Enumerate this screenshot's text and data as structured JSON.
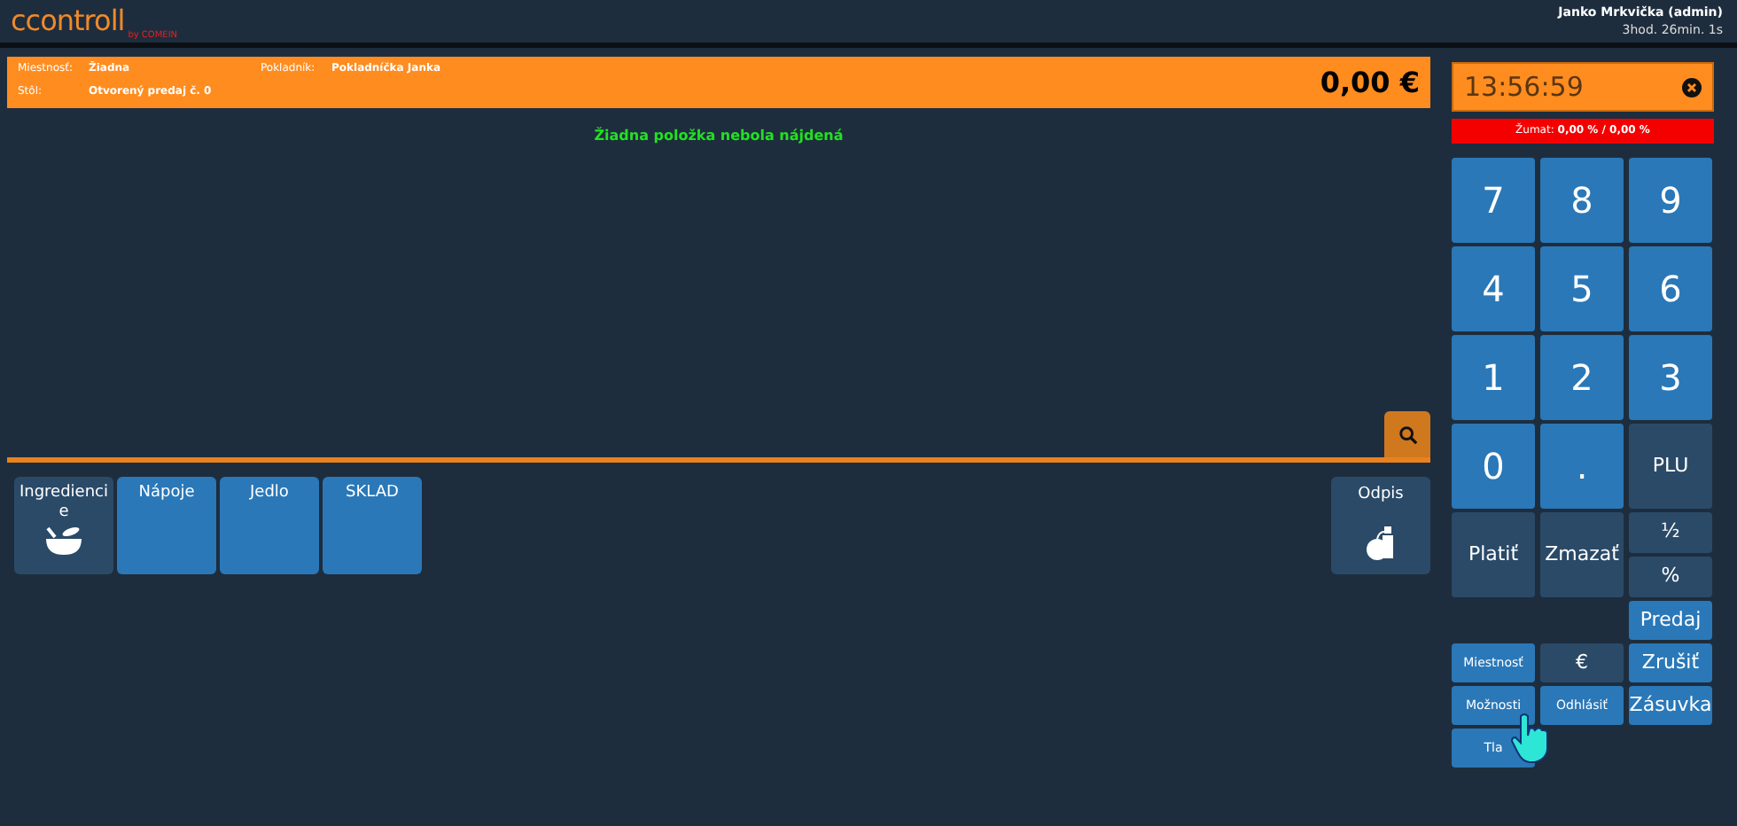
{
  "header": {
    "logo": "ccontroll",
    "logo_suffix": "by COMEIN",
    "user": "Janko Mrkvička (admin)",
    "session": "3hod. 26min. 1s"
  },
  "info_bar": {
    "fields": [
      {
        "label": "Miestnosť:",
        "value": "Žiadna"
      },
      {
        "label": "Pokladník:",
        "value": "Pokladníčka Janka"
      },
      {
        "label": "Stôl:",
        "value": "Otvorený predaj č. **0**"
      }
    ],
    "total": "0,00 €"
  },
  "message": "Žiadna položka nebola nájdená",
  "categories": [
    {
      "label": "Ingrediencie",
      "kind": "folder"
    },
    {
      "label": "Nápoje",
      "kind": "category"
    },
    {
      "label": "Jedlo",
      "kind": "category"
    },
    {
      "label": "SKLAD",
      "kind": "category"
    }
  ],
  "write_off": {
    "label": "Odpis"
  },
  "clock": "13:56:59",
  "discount": {
    "label": "Žumat:",
    "value": "0,00 % / 0,00 %"
  },
  "keys": [
    {
      "label": "7",
      "kind": "digit"
    },
    {
      "label": "8",
      "kind": "digit"
    },
    {
      "label": "9",
      "kind": "digit"
    },
    {
      "label": "4",
      "kind": "digit"
    },
    {
      "label": "5",
      "kind": "digit"
    },
    {
      "label": "6",
      "kind": "digit"
    },
    {
      "label": "1",
      "kind": "digit"
    },
    {
      "label": "2",
      "kind": "digit"
    },
    {
      "label": "3",
      "kind": "digit"
    },
    {
      "label": "0",
      "kind": "digit"
    },
    {
      "label": ".",
      "kind": "digit"
    },
    {
      "label": "PLU",
      "kind": "dark"
    },
    {
      "label": "Platiť",
      "kind": "dark"
    },
    {
      "label": "Zmazať",
      "kind": "dark"
    },
    {
      "label": "½",
      "kind": "dark"
    },
    {
      "label": "%",
      "kind": "dark"
    },
    {
      "label": "Predaj",
      "kind": "action"
    },
    {
      "label": "Miestnosť",
      "kind": "small"
    },
    {
      "label": "€",
      "kind": "dark"
    },
    {
      "label": "Zrušiť",
      "kind": "action"
    },
    {
      "label": "Možnosti",
      "kind": "small"
    },
    {
      "label": "Odhlásiť",
      "kind": "small"
    },
    {
      "label": "Zásuvka",
      "kind": "action"
    },
    {
      "label": "Tla",
      "kind": "small"
    }
  ]
}
